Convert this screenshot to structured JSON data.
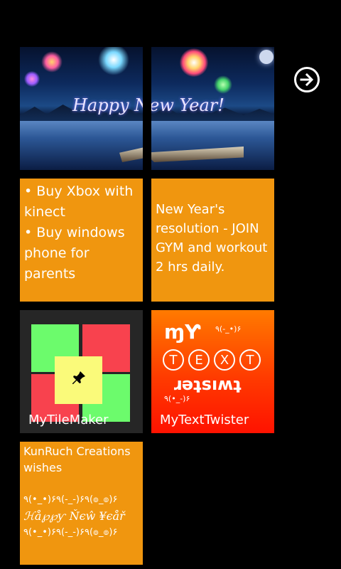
{
  "tiles": {
    "photo_text": "Happy New Year!",
    "note_left_line1": "• Buy Xbox with kinect",
    "note_left_line2": "• Buy windows phone for parents",
    "note_right": "New Year's resolution - JOIN GYM and workout 2 hrs daily.",
    "tilemaker_label": "MyTileMaker",
    "texttwister_label": "MyTextTwister",
    "twister_my": "ɱƳ",
    "twister_face_top": "٩(-_•)۶",
    "twister_circle_letters": [
      "T",
      "E",
      "X",
      "T"
    ],
    "twister_upside": "ɹǝʇsıʍʇ",
    "twister_face_bottom": "٩(•_-)۶",
    "kunruch_line1": "KunRuch Creations wishes",
    "kunruch_faces1": "٩(•_•)۶٩(-_-)۶٩(๏_๏)۶",
    "kunruch_happy": "ℋå℘℘ƴ Ňєŵ ¥єåř",
    "kunruch_faces2": "٩(•_•)۶٩(-_-)۶٩(๏_๏)۶"
  },
  "colors": {
    "orange": "#F0960F",
    "green": "#6CFB6C",
    "red": "#F8424E",
    "yellow": "#FAFA7A",
    "tile_dark": "#262626"
  },
  "icons": [
    "arrow-right-circle-icon",
    "pin-icon"
  ]
}
